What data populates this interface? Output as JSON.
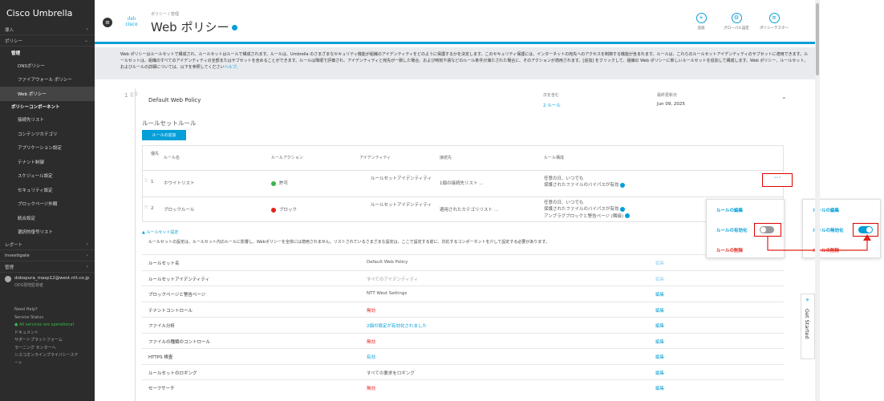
{
  "sidebar": {
    "brand": "Cisco Umbrella",
    "deploy": "導入",
    "policies": "ポリシー",
    "management": "管理",
    "dns_policy": "DNSポリシー",
    "firewall_policy": "ファイアウォール ポリシー",
    "web_policy": "Web ポリシー",
    "components": "ポリシーコンポーネント",
    "component_items": [
      "接続先リスト",
      "コンテンツカテゴリ",
      "アプリケーション設定",
      "テナント制御",
      "スケジュール設定",
      "セキュリティ設定",
      "ブロックページ外観",
      "統合設定",
      "選択的復号リスト"
    ],
    "reports": "レポート",
    "investigate": "Investigate",
    "admin": "管理",
    "user_email": "dokopura_masp12@west.ntt.co.jp",
    "user_org": "ODS現地監視者",
    "help_title": "Need Help?",
    "service_status": "Service Status",
    "status_ok": "● All services are operational",
    "help_links": [
      "ドキュメント",
      "サポートプラットフォーム",
      "ラーニング センターへ",
      "シスコオンラインプライバシーステート"
    ]
  },
  "header": {
    "breadcrumb": "ポリシー / 管理",
    "cisco": "cisco",
    "title": "Web ポリシー",
    "actions": [
      "追加",
      "グローバル設定",
      "ポリシーテスター"
    ]
  },
  "description": {
    "text": "Web ポリシーはルールセットで構成され、ルールセットはルールで構成されます。ルールは、Umbrella のさまざまなセキュリティ機能が組織のアイデンティティをどのように保護するかを決定します。このセキュリティ保護には、インターネットの宛先へのアクセスを制御する機能が含まれます。ルールは、これらのルールセットアイデンティティのサブセットに適用できます。ルールセットは、組織のすべてのアイデンティティの全部またはサブセットを含めることができます。ルールは降順で評価され、アイデンティティと宛先が一致した場合、および時刻や週などのルール条件が満たされた場合に、そのアクションが適用されます。[追加] をクリックして、組織の Web ポリシーに新しいルールセットを追加して構成します。Web ポリシー、ルールセット、およびルールの詳細については、以下を参照してください",
    "link": "ヘルプ。"
  },
  "ruleset": {
    "number": "1",
    "name": "Default Web Policy",
    "contains_label": "次を含む",
    "contains_value": "2 ルール",
    "updated_label": "最終更新日",
    "updated_value": "Jun 09, 2025",
    "rules_title": "ルールセットルール",
    "add_rule": "ルールの追加",
    "columns": [
      "優先",
      "ルール名",
      "ルールアクション",
      "アイデンティティ",
      "接続先",
      "ルール構成"
    ],
    "rules": [
      {
        "priority": "1",
        "name": "ホワイトリスト",
        "action": "許可",
        "identity": "ルールセットアイデンティティ",
        "destination": "1個の接続先リスト ...",
        "config1": "任意の日、いつでも",
        "config2": "保護されたファイルのバイパスが有効",
        "config3": ""
      },
      {
        "priority": "2",
        "name": "ブロックルール",
        "action": "ブロック",
        "identity": "ルールセットアイデンティティ",
        "destination": "適用されたカテゴリリスト ...",
        "config1": "任意の日、いつでも",
        "config2": "保護されたファイルのバイパスが有効",
        "config3": "アンプラグブロックと警告ページ (隣接)"
      }
    ],
    "more": "⋯",
    "settings_toggle": "▲ ルールセット設定",
    "settings_desc": "ルールセットの設定は、ルールセット内のルールに影響し、Webポリシーを全体には適用されません。リストされているさまざまな設定は、ここで設定する前に、対応するコンポーネントを介して設定する必要があります。",
    "settings": [
      {
        "key": "ルールセット名",
        "value": "Default Web Policy",
        "edit": "編集"
      },
      {
        "key": "ルールセットアイデンティティ",
        "value": "すべてのアイデンティティ",
        "edit": "編集"
      },
      {
        "key": "ブロックページと警告ページ",
        "value": "NTT West Settings",
        "edit": "編集"
      },
      {
        "key": "テナントコントロール",
        "value": "無効",
        "edit": "編集"
      },
      {
        "key": "ファイル分析",
        "value": "2個の設定が有効化されました",
        "edit": "編集"
      },
      {
        "key": "ファイルの種類のコントロール",
        "value": "無効",
        "edit": "編集"
      },
      {
        "key": "HTTPS 検査",
        "value": "有効",
        "edit": "編集"
      },
      {
        "key": "ルールセットのロギング",
        "value": "すべての要求をロギング",
        "edit": "編集"
      },
      {
        "key": "セーフサーチ",
        "value": "無効",
        "edit": "編集"
      }
    ]
  },
  "popup_left": {
    "edit": "ルールの編集",
    "enable": "ルールの有効化",
    "delete": "ルールの削除"
  },
  "popup_right": {
    "edit": "ルールの編集",
    "disable": "ルールの無効化",
    "delete": "ルールの削除"
  },
  "get_started": "Get Started",
  "colors": {
    "accent": "#049fd9",
    "danger": "#e2231a",
    "success": "#3cb34a",
    "highlight": "#d00000"
  }
}
